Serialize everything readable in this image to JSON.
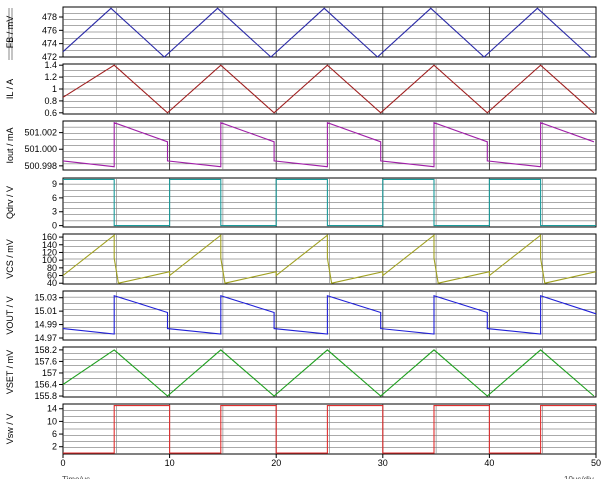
{
  "chart_data": [
    {
      "type": "line",
      "ylabel": "FB / mV",
      "yticks": [
        472,
        474,
        476,
        478
      ],
      "ylim": [
        472,
        479.5
      ],
      "color": "#2c2ca8",
      "x": [
        0,
        4.5,
        9.5,
        14.5,
        19.5,
        24.5,
        29.5,
        34.5,
        39.5,
        44.5,
        49.5
      ],
      "y": [
        472.8,
        479.3,
        472.0,
        479.3,
        472.0,
        479.3,
        472.0,
        479.3,
        472.0,
        479.3,
        472.0
      ]
    },
    {
      "type": "line",
      "ylabel": "IL / A",
      "yticks": [
        0.6,
        0.8,
        1.0,
        1.2,
        1.4
      ],
      "ylim": [
        0.58,
        1.42
      ],
      "color": "#a02020",
      "x": [
        0,
        4.8,
        9.8,
        14.8,
        19.8,
        24.8,
        29.8,
        34.8,
        39.8,
        44.8,
        49.8
      ],
      "y": [
        0.86,
        1.4,
        0.6,
        1.4,
        0.6,
        1.4,
        0.6,
        1.4,
        0.6,
        1.4,
        0.6
      ]
    },
    {
      "type": "line",
      "ylabel": "Iout / mA",
      "yticks": [
        500.998,
        501.0,
        501.002
      ],
      "yticklabels": [
        "500.998",
        "501.000",
        "501.002"
      ],
      "ylim": [
        500.9975,
        501.0034
      ],
      "color": "#a020a8",
      "x": [
        0,
        4.8,
        4.8,
        9.8,
        9.8,
        14.8,
        14.8,
        19.8,
        19.8,
        24.8,
        24.8,
        29.8,
        29.8,
        34.8,
        34.8,
        39.8,
        39.8,
        44.8,
        44.8,
        49.8
      ],
      "y": [
        500.9986,
        500.9979,
        501.0032,
        501.0009,
        500.9986,
        500.9979,
        501.0032,
        501.0009,
        500.9986,
        500.9979,
        501.0032,
        501.0009,
        500.9986,
        500.9979,
        501.0032,
        501.0009,
        500.9986,
        500.9979,
        501.0032,
        501.0009
      ]
    },
    {
      "type": "line",
      "ylabel": "Qdrv / V",
      "yticks": [
        0,
        3,
        6,
        9
      ],
      "ylim": [
        -0.3,
        10.3
      ],
      "color": "#1a9a9a",
      "x": [
        0,
        4.8,
        4.8,
        10,
        10,
        14.8,
        14.8,
        20,
        20,
        24.8,
        24.8,
        30,
        30,
        34.8,
        34.8,
        40,
        40,
        44.8,
        44.8,
        50
      ],
      "y": [
        10,
        10,
        0,
        0,
        10,
        10,
        0,
        0,
        10,
        10,
        0,
        0,
        10,
        10,
        0,
        0,
        10,
        10,
        0,
        0
      ]
    },
    {
      "type": "line",
      "ylabel": "VCS / mV",
      "yticks": [
        40,
        60,
        80,
        100,
        120,
        140,
        160
      ],
      "ylim": [
        38,
        168
      ],
      "color": "#a0a020",
      "x": [
        0,
        4.8,
        4.8,
        5.2,
        10,
        10,
        14.8,
        14.8,
        15.2,
        20,
        20,
        24.8,
        24.8,
        25.2,
        30,
        30,
        34.8,
        34.8,
        35.2,
        40,
        40,
        44.8,
        44.8,
        45.2,
        50
      ],
      "y": [
        60,
        165,
        105,
        40,
        70,
        60,
        165,
        105,
        40,
        70,
        60,
        165,
        105,
        40,
        70,
        60,
        165,
        105,
        40,
        70,
        60,
        165,
        105,
        40,
        70
      ]
    },
    {
      "type": "line",
      "ylabel": "VOUT / V",
      "yticks": [
        14.97,
        14.99,
        15.01,
        15.03
      ],
      "ylim": [
        14.967,
        15.04
      ],
      "color": "#2020d8",
      "x": [
        0,
        4.8,
        4.8,
        9.8,
        9.8,
        14.8,
        14.8,
        19.8,
        19.8,
        24.8,
        24.8,
        29.8,
        29.8,
        34.8,
        34.8,
        39.8,
        39.8,
        44.8,
        44.8,
        50
      ],
      "y": [
        14.984,
        14.976,
        15.033,
        15.008,
        14.984,
        14.976,
        15.033,
        15.008,
        14.984,
        14.976,
        15.033,
        15.008,
        14.984,
        14.976,
        15.033,
        15.008,
        14.984,
        14.976,
        15.033,
        15.006
      ]
    },
    {
      "type": "line",
      "ylabel": "VSET / mV",
      "yticks": [
        155.8,
        156.4,
        157.0,
        157.6,
        158.2
      ],
      "ylim": [
        155.75,
        158.35
      ],
      "color": "#20a020",
      "x": [
        0,
        4.8,
        9.8,
        14.8,
        19.8,
        24.8,
        29.8,
        34.8,
        39.8,
        44.8,
        49.8
      ],
      "y": [
        156.4,
        158.2,
        155.8,
        158.2,
        155.8,
        158.2,
        155.8,
        158.2,
        155.8,
        158.2,
        155.8
      ]
    },
    {
      "type": "line",
      "ylabel": "Vsw / V",
      "yticks": [
        2,
        6,
        10,
        14
      ],
      "ylim": [
        -0.3,
        15.5
      ],
      "color": "#e03030",
      "x": [
        0,
        4.8,
        4.8,
        10,
        10,
        14.8,
        14.8,
        20,
        20,
        24.8,
        24.8,
        30,
        30,
        34.8,
        34.8,
        40,
        40,
        44.8,
        44.8,
        50
      ],
      "y": [
        0,
        0,
        15,
        15,
        0,
        0,
        15,
        15,
        0,
        0,
        15,
        15,
        0,
        0,
        15,
        15,
        0,
        0,
        15,
        15
      ]
    }
  ],
  "x_axis": {
    "xlim": [
      0,
      50
    ],
    "ticks": [
      0,
      10,
      20,
      30,
      40,
      50
    ],
    "label_left": "Time/us",
    "label_right": "10us/div"
  }
}
